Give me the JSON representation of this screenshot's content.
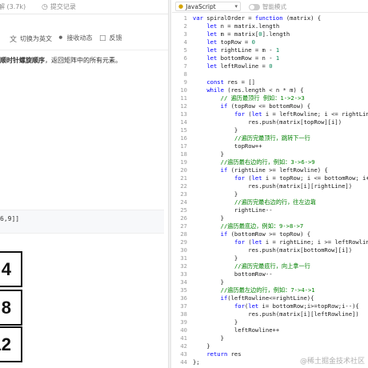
{
  "left_tabs": [
    {
      "label": "解 (3.7k)",
      "icon": "solutions-icon"
    },
    {
      "label": "提交记录",
      "icon": "clock-icon"
    }
  ],
  "left_actions": [
    {
      "label": "切换为英文",
      "icon": "translate-icon"
    },
    {
      "label": "接收动态",
      "icon": "bell-icon"
    },
    {
      "label": "反馈",
      "icon": "feedback-icon"
    }
  ],
  "description": {
    "bold": "顺时针螺旋顺序",
    "rest": "，返回矩阵中的所有元素。"
  },
  "example_output": "6,9]]",
  "matrix_cells": [
    "4",
    "8",
    "12"
  ],
  "editor": {
    "language": "JavaScript",
    "smart_mode": "智能模式"
  },
  "code_lines": [
    "var spiralOrder = function (matrix) {",
    "    let n = matrix.length",
    "    let m = matrix[0].length",
    "    let topRow = 0",
    "    let rightLine = m - 1",
    "    let bottomRow = n - 1",
    "    let leftRowline = 0",
    "",
    "    const res = []",
    "    while (res.length < n * m) {",
    "        // 遍历最顶行 例如：1->2->3",
    "        if (topRow <= bottomRow) {",
    "            for (let i = leftRowline; i <= rightLine; i",
    "                res.push(matrix[topRow][i])",
    "            }",
    "            //遍历完最顶行，跳转下一行",
    "            topRow++",
    "        }",
    "        //遍历最右边的行，例如：3->6->9",
    "        if (rightLine >= leftRowline) {",
    "            for (let i = topRow; i <= bottomRow; i++) {",
    "                res.push(matrix[i][rightLine])",
    "            }",
    "            //遍历完最右边的行，往左边靠",
    "            rightLine--",
    "        }",
    "        //遍历最底边，例如：9->8->7",
    "        if (bottomRow >= topRow) {",
    "            for (let i = rightLine; i >= leftRowline; i",
    "                res.push(matrix[bottomRow][i])",
    "            }",
    "            //遍历完最底行，向上拿一行",
    "            bottomRow--",
    "        }",
    "        //遍历最左边的行，例如：7->4->1",
    "        if(leftRowline<=rightLine){",
    "            for(let i= bottomRow;i>=topRow;i--){",
    "                res.push(matrix[i][leftRowline])",
    "            }",
    "            leftRowline++",
    "        }",
    "    }",
    "    return res",
    "};"
  ],
  "watermark": "@稀土掘金技术社区",
  "colors": {
    "keyword": "#0000ff",
    "comment": "#008000",
    "number": "#098658",
    "line_number": "#9a9a9a"
  }
}
